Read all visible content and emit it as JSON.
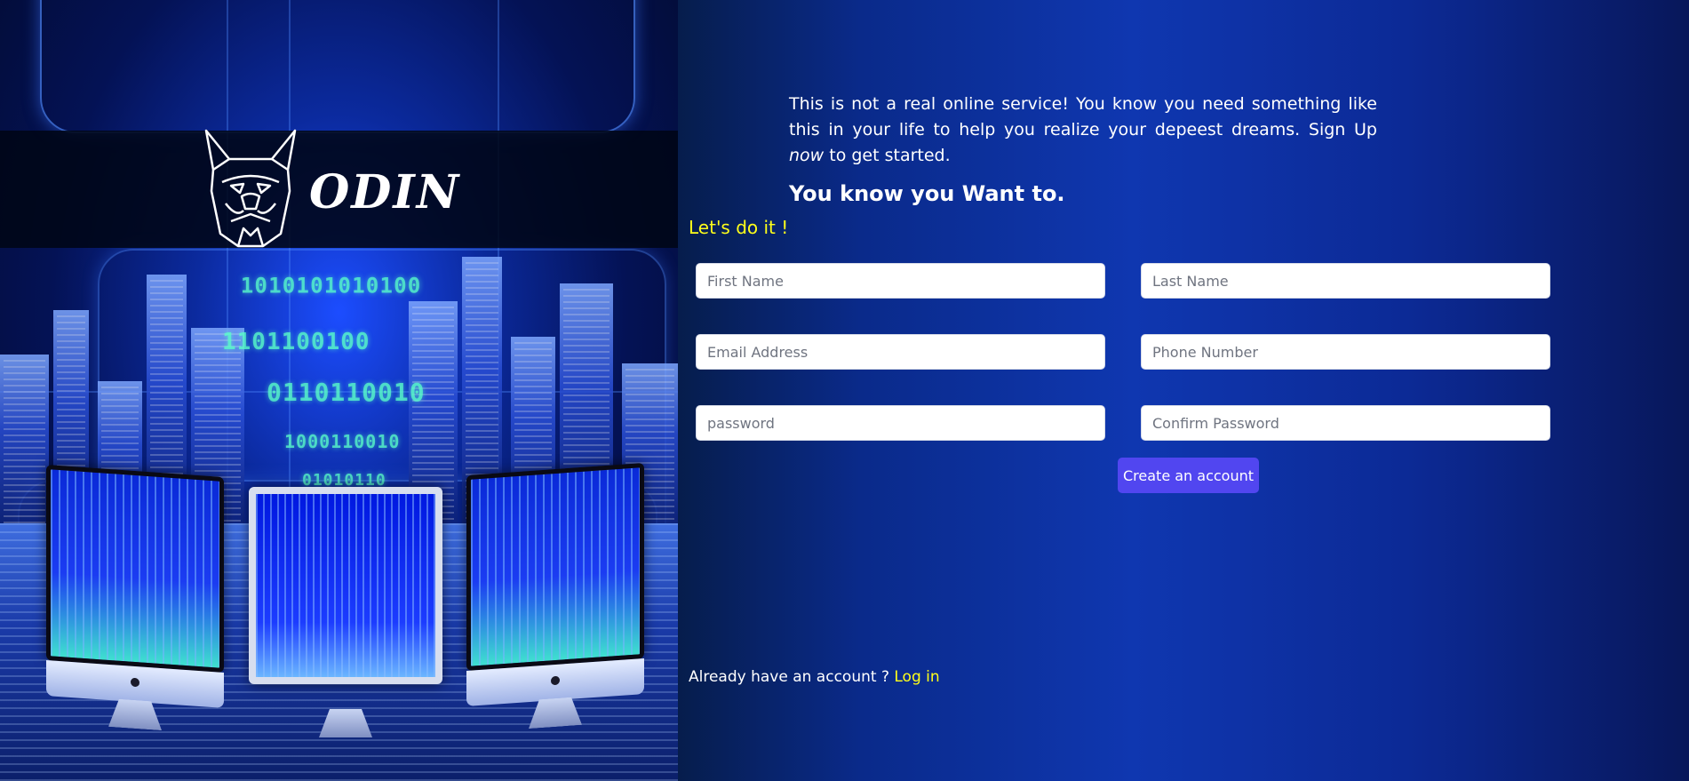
{
  "brand": {
    "name": "ODIN"
  },
  "intro": {
    "text_before": "This is not a real online service! You know you need something like this in your life to help you realize your depeest dreams. Sign Up ",
    "emphasis": "now",
    "text_after": " to get started."
  },
  "headline": "You know you Want to.",
  "subheadline": "Let's do it !",
  "form": {
    "first_name_placeholder": "First Name",
    "last_name_placeholder": "Last Name",
    "email_placeholder": "Email Address",
    "phone_placeholder": "Phone Number",
    "password_placeholder": "password",
    "confirm_password_placeholder": "Confirm Password",
    "submit_label": "Create an account"
  },
  "footer": {
    "prompt": "Already have an account ?",
    "login_link": "Log in"
  },
  "colors": {
    "accent_yellow": "#ffff1a",
    "button_purple": "#5146f0"
  }
}
